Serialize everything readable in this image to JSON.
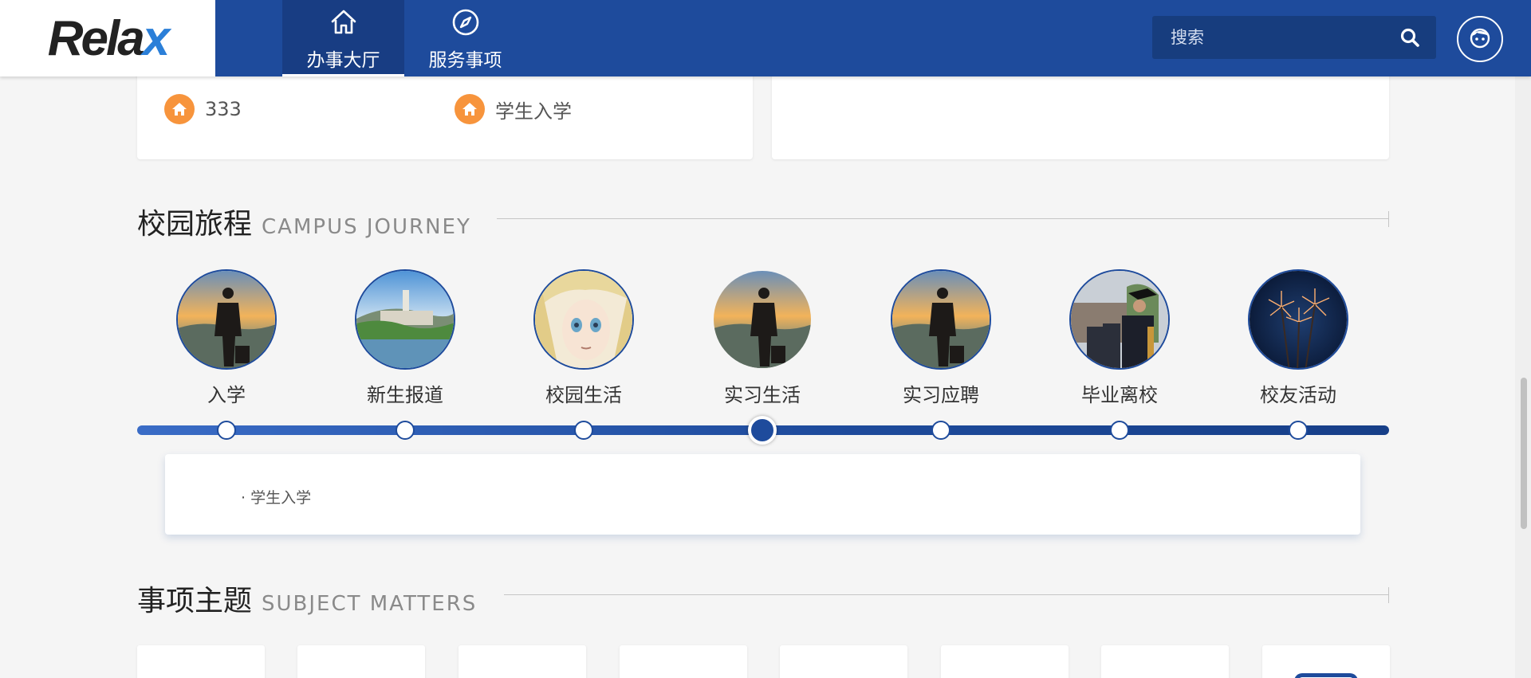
{
  "app": {
    "logo_text": "Relax",
    "logo_accent": "#2b7fd8",
    "brand_color": "#1e4b9c"
  },
  "header": {
    "tabs": [
      {
        "label": "办事大厅",
        "icon": "home-icon",
        "active": true
      },
      {
        "label": "服务事项",
        "icon": "compass-icon",
        "active": false
      }
    ],
    "search": {
      "placeholder": "搜索",
      "icon": "search-icon"
    },
    "avatar_icon": "user-face-icon"
  },
  "quick_links": [
    {
      "label": "333",
      "icon": "home-icon"
    },
    {
      "label": "学生入学",
      "icon": "home-icon"
    }
  ],
  "campus_journey": {
    "title_cn": "校园旅程",
    "title_en": "CAMPUS JOURNEY",
    "stages": [
      {
        "label": "入学",
        "image": "silhouette-sunset"
      },
      {
        "label": "新生报道",
        "image": "campus-lake"
      },
      {
        "label": "校园生活",
        "image": "anime-portrait"
      },
      {
        "label": "实习生活",
        "image": "silhouette-sunset",
        "active": true
      },
      {
        "label": "实习应聘",
        "image": "silhouette-sunset"
      },
      {
        "label": "毕业离校",
        "image": "graduation"
      },
      {
        "label": "校友活动",
        "image": "fireworks"
      }
    ],
    "active_index": 3,
    "detail_items": [
      "· 学生入学"
    ]
  },
  "subject_matters": {
    "title_cn": "事项主题",
    "title_en": "SUBJECT MATTERS",
    "tile_count": 8
  }
}
